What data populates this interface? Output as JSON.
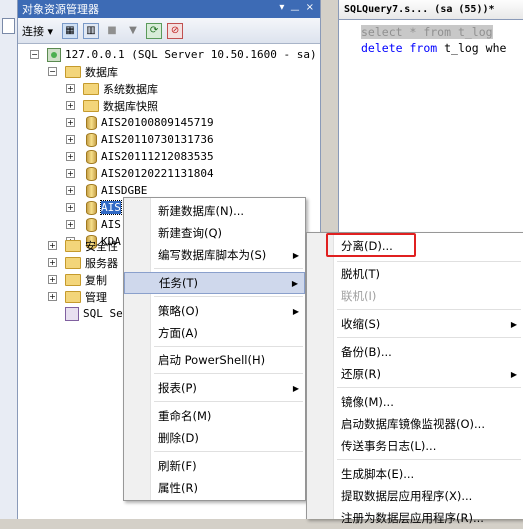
{
  "object_explorer": {
    "title": "对象资源管理器",
    "title_controls": [
      "▾",
      "ᅳ",
      "×"
    ],
    "toolbar": {
      "connect_label": "连接 ▾"
    },
    "tree": {
      "server": "127.0.0.1 (SQL Server 10.50.1600 - sa)",
      "databases": "数据库",
      "system_databases": "系统数据库",
      "snapshots": "数据库快照",
      "db_items": [
        "AIS20100809145719",
        "AIS20110730131736",
        "AIS20111212083535",
        "AIS20120221131804",
        "AISDGBE",
        "AIS",
        "AIS",
        "KDA"
      ],
      "security": "安全性",
      "server_objects": "服务器",
      "replication": "复制",
      "management": "管理",
      "agent": "SQL Ser"
    }
  },
  "editor": {
    "tab_label": "SQLQuery7.s... (sa (55))*",
    "lines": [
      {
        "kw1": "select",
        "rest1": " * ",
        "kw2": "from",
        "rest2": " t_log"
      },
      {
        "kw1": "delete",
        "rest1": " ",
        "kw2": "from",
        "rest2": " t_log whe"
      }
    ]
  },
  "context_menu": {
    "items": [
      "新建数据库(N)...",
      "新建查询(Q)",
      "编写数据库脚本为(S)",
      "任务(T)",
      "策略(O)",
      "方面(A)",
      "启动 PowerShell(H)",
      "报表(P)",
      "重命名(M)",
      "删除(D)",
      "刷新(F)",
      "属性(R)"
    ]
  },
  "tasks_menu": {
    "items": [
      "分离(D)...",
      "脱机(T)",
      "联机(I)",
      "收缩(S)",
      "备份(B)...",
      "还原(R)",
      "镜像(M)...",
      "启动数据库镜像监视器(O)...",
      "传送事务日志(L)...",
      "生成脚本(E)...",
      "提取数据层应用程序(X)...",
      "注册为数据层应用程序(R)..."
    ]
  },
  "colors": {
    "highlight": "#cfd8ec",
    "title_bar": "#3d6bb5",
    "annotation": "#e02020"
  }
}
